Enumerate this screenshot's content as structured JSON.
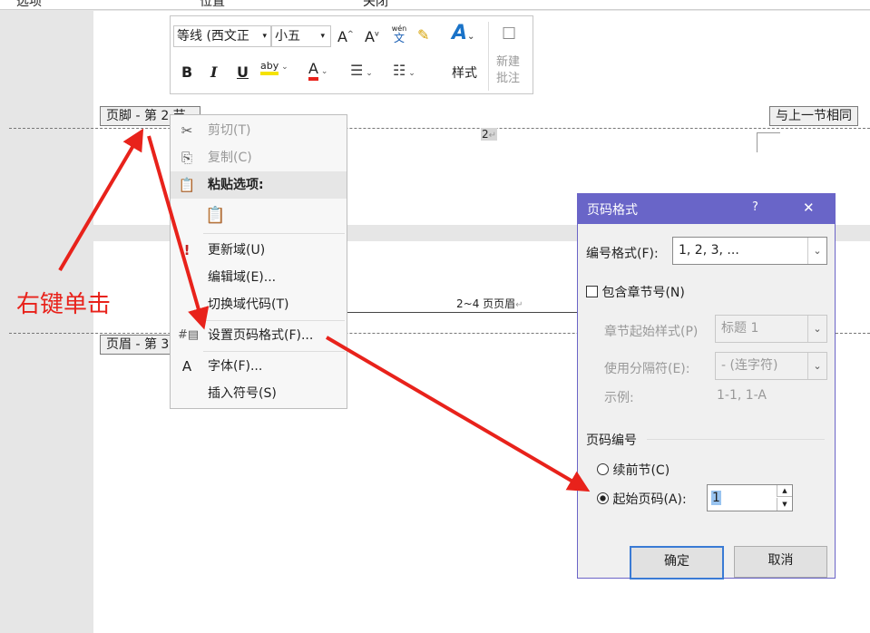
{
  "ribbon_top": {
    "tab1": "选项",
    "tab2": "位置",
    "tab3": "关闭"
  },
  "mini_toolbar": {
    "font_name": "等线 (西文正",
    "font_size": "小五",
    "grow_font": "A",
    "shrink_font": "A",
    "phonetic_top": "wén",
    "phonetic_bottom": "文",
    "bold": "B",
    "italic": "I",
    "underline": "U",
    "highlight": "aby",
    "font_color": "A",
    "styles_label": "样式",
    "new_comment_line1": "新建",
    "new_comment_line2": "批注"
  },
  "doc": {
    "footer_tab": "页脚 - 第 2 节 -",
    "same_as_previous": "与上一节相同",
    "page_number": "2",
    "header_tab": "页眉 - 第 3 节 -",
    "header_text": "2~4 页页眉"
  },
  "annotation": {
    "right_click": "右键单击"
  },
  "context_menu": {
    "cut": "剪切(T)",
    "copy": "复制(C)",
    "paste_options": "粘贴选项:",
    "update_field": "更新域(U)",
    "edit_field": "编辑域(E)...",
    "toggle_field_codes": "切换域代码(T)",
    "format_page_numbers": "设置页码格式(F)...",
    "font": "字体(F)...",
    "insert_symbol": "插入符号(S)"
  },
  "dialog": {
    "title": "页码格式",
    "help": "?",
    "close": "✕",
    "number_format_label": "编号格式(F):",
    "number_format_value": "1, 2, 3, ...",
    "include_chapter": "包含章节号(N)",
    "chapter_style_label": "章节起始样式(P)",
    "chapter_style_value": "标题 1",
    "separator_label": "使用分隔符(E):",
    "separator_value": "-  (连字符)",
    "example_label": "示例:",
    "example_value": "1-1, 1-A",
    "numbering_section": "页码编号",
    "continue_label": "续前节(C)",
    "start_at_label": "起始页码(A):",
    "start_at_value": "1",
    "ok": "确定",
    "cancel": "取消"
  },
  "colors": {
    "dialog_title_bg": "#6965c8",
    "arrow": "#e8221b"
  }
}
